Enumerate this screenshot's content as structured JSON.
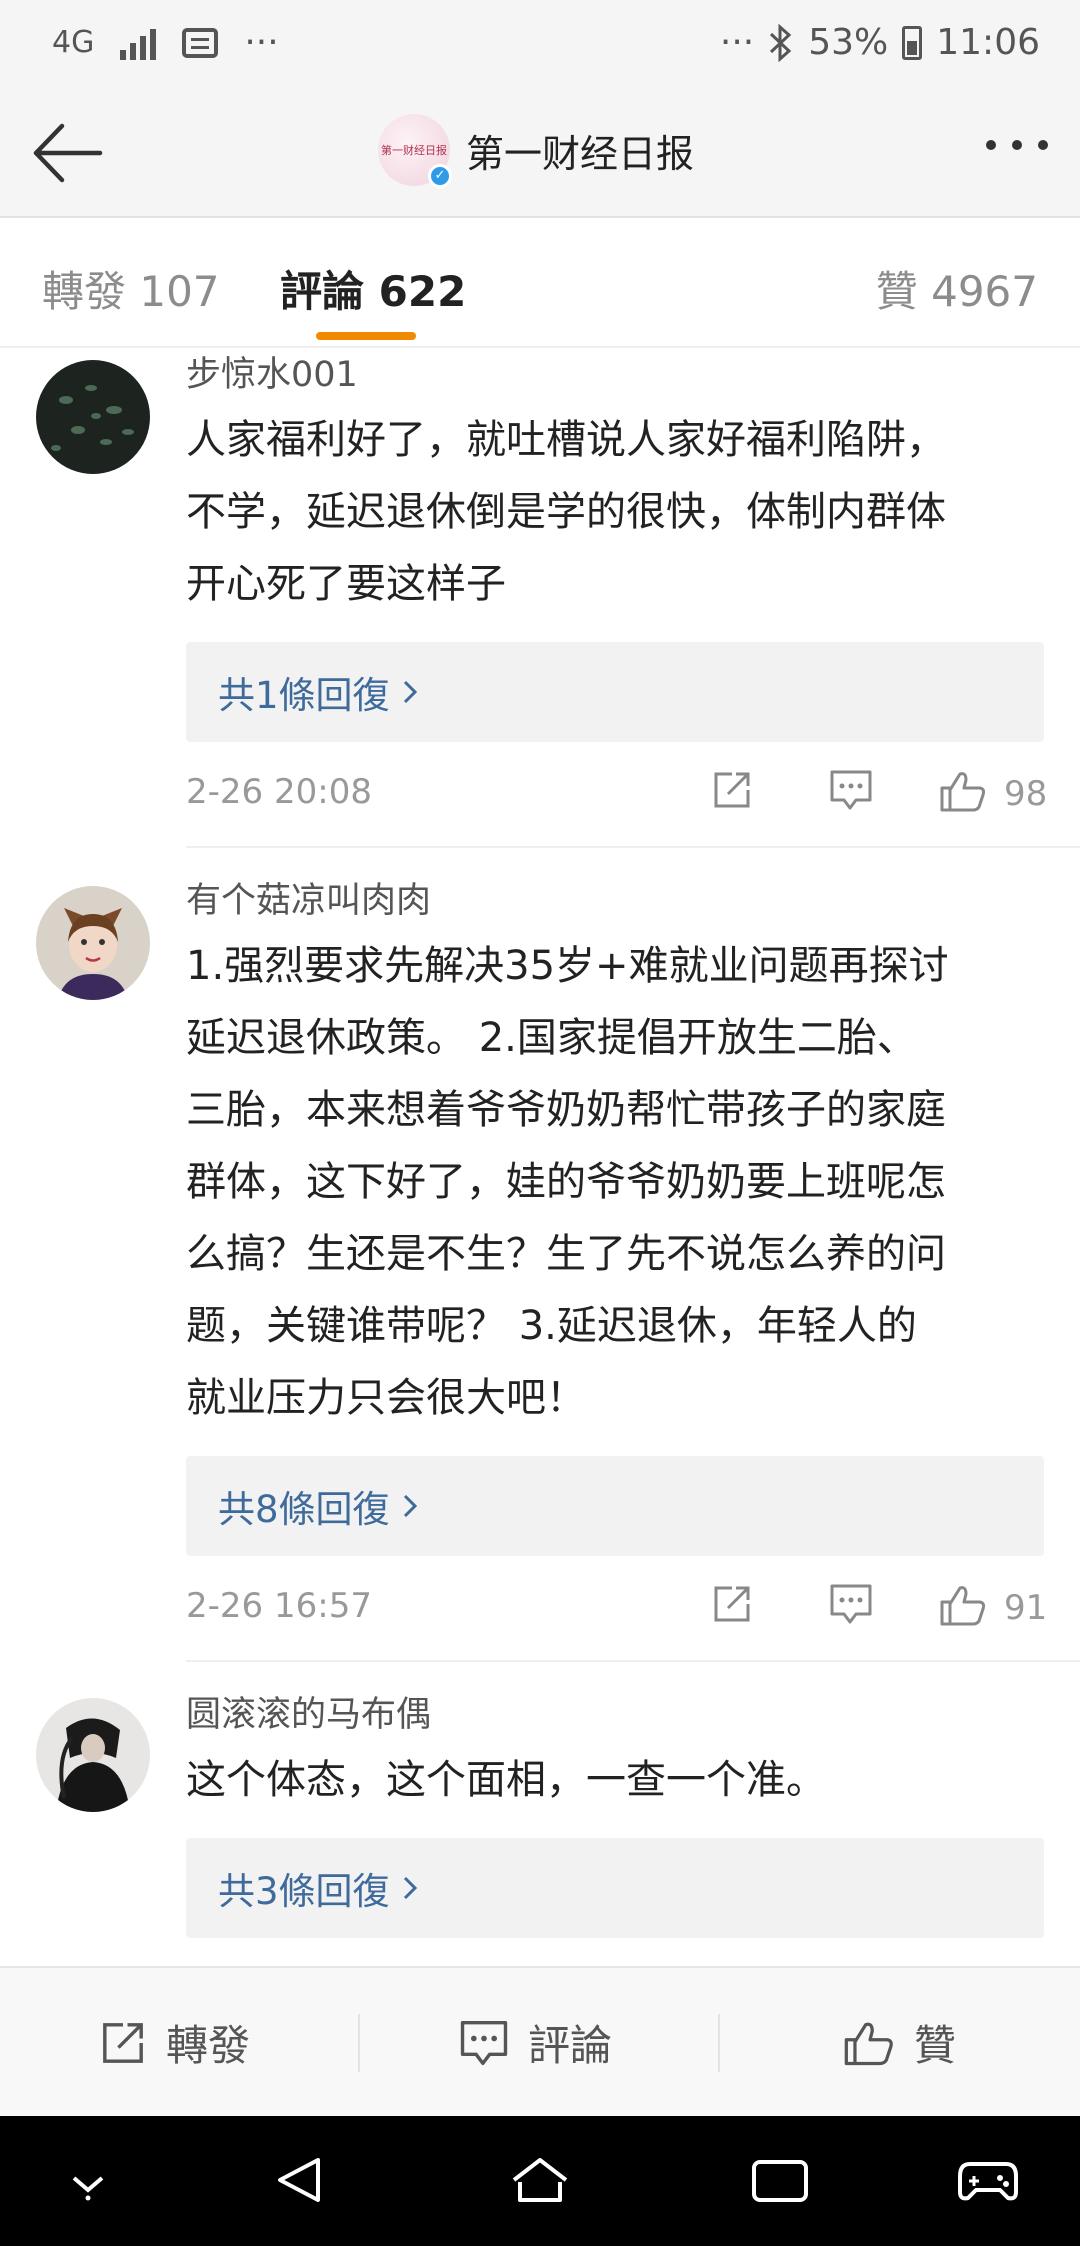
{
  "status_bar": {
    "network": "4G",
    "dots_left": "···",
    "dots_right": "···",
    "battery": "53%",
    "time": "11:06"
  },
  "header": {
    "logo_text": "第一财经日报",
    "title": "第一财经日报"
  },
  "tabs": [
    {
      "label": "轉發 107"
    },
    {
      "label": "評論 622"
    },
    {
      "label": "贊 4967"
    }
  ],
  "comments": [
    {
      "user": "步惊水001",
      "text_lines": [
        "人家福利好了，就吐槽说人家好福利陷阱，",
        "不学，延迟退休倒是学的很快，体制内群体",
        "开心死了要这样子"
      ],
      "replies": "共1條回復",
      "time": "2-26 20:08",
      "likes": "98"
    },
    {
      "user": "有个菇凉叫肉肉",
      "text_lines": [
        "1.强烈要求先解决35岁+难就业问题再探讨",
        "延迟退休政策。 2.国家提倡开放生二胎、",
        "三胎，本来想着爷爷奶奶帮忙带孩子的家庭",
        "群体，这下好了，娃的爷爷奶奶要上班呢怎",
        "么搞？生还是不生？生了先不说怎么养的问",
        "题，关键谁带呢？ 3.延迟退休，年轻人的",
        "就业压力只会很大吧！"
      ],
      "replies": "共8條回復",
      "time": "2-26 16:57",
      "likes": "91"
    },
    {
      "user": "圆滚滚的马布偶",
      "text_lines": [
        "这个体态，这个面相，一查一个准。"
      ],
      "replies": "共3條回復"
    }
  ],
  "action_bar": {
    "repost": "轉發",
    "comment": "評論",
    "like": "贊"
  },
  "icons": {
    "back": "arrow-left-icon",
    "more": "more-dots-icon",
    "share": "share-icon",
    "comment": "comment-icon",
    "like": "thumbs-up-icon"
  },
  "colors": {
    "tab_indicator": "#f08b00",
    "reply_link": "#3e6a9c",
    "verified": "#2f9ae8"
  }
}
